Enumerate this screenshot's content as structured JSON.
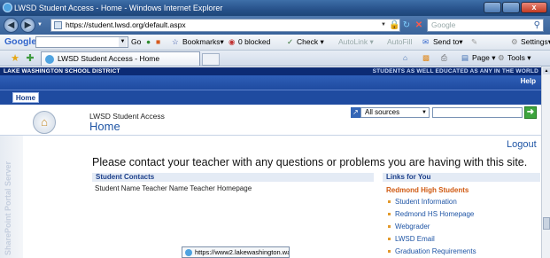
{
  "window": {
    "title": "LWSD Student Access - Home - Windows Internet Explorer",
    "close": "x"
  },
  "address_bar": {
    "url": "https://student.lwsd.org/default.aspx",
    "search_placeholder": "Google"
  },
  "google_toolbar": {
    "logo": "Google",
    "go": "Go",
    "bookmarks": "Bookmarks▾",
    "blocked": "0 blocked",
    "check": "Check ▾",
    "autolink": "AutoLink ▾",
    "autofill": "AutoFill",
    "send": "Send to▾",
    "settings": "Settings▾"
  },
  "tab": {
    "label": "LWSD Student Access - Home"
  },
  "command_bar": {
    "page": "Page ▾",
    "tools": "Tools ▾"
  },
  "site": {
    "district": "LAKE WASHINGTON SCHOOL DISTRICT",
    "slogan": "STUDENTS AS WELL EDUCATED AS ANY IN THE WORLD",
    "help": "Help",
    "home_tab": "Home",
    "site_name": "LWSD Student Access",
    "page_name": "Home",
    "search_scope": "All sources",
    "sidebar_text": "SharePoint Portal Server"
  },
  "content": {
    "logout": "Logout",
    "message": "Please contact your teacher with any questions or problems you are having with this site.",
    "contacts_header": "Student Contacts",
    "contacts_columns": "Student Name   Teacher Name Teacher Homepage",
    "links_header": "Links for You",
    "links_subheader": "Redmond High Students",
    "links": [
      "Student Information",
      "Redmond HS Homepage",
      "Webgrader",
      "LWSD Email",
      "Graduation Requirements"
    ]
  },
  "status_tooltip": {
    "url": "https://www2.lakewashington.wa"
  },
  "colors": {
    "district_band": "#0c2b74",
    "nav_blue": "#1f4ba0",
    "accent_orange": "#d05a12",
    "link_blue": "#1f55a5"
  }
}
